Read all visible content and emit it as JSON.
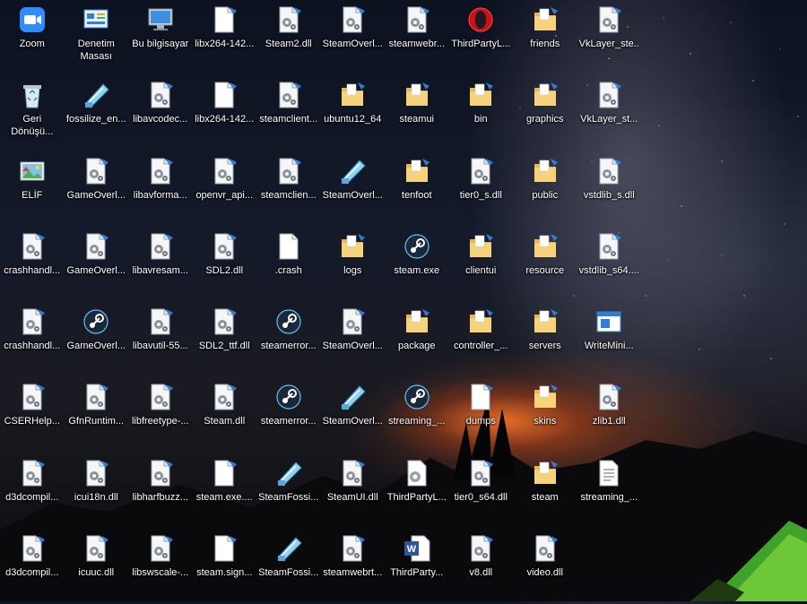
{
  "desktop": {
    "columns": [
      [
        {
          "label": "Zoom",
          "icon": "zoom"
        },
        {
          "label": "Geri Dönüşü...",
          "icon": "recycle"
        },
        {
          "label": "ELİF",
          "icon": "image"
        },
        {
          "label": "crashhandl...",
          "icon": "dll"
        },
        {
          "label": "crashhandl...",
          "icon": "dll"
        },
        {
          "label": "CSERHelp...",
          "icon": "dll"
        },
        {
          "label": "d3dcompil...",
          "icon": "dll"
        },
        {
          "label": "d3dcompil...",
          "icon": "dll"
        }
      ],
      [
        {
          "label": "Denetim Masası",
          "icon": "control-panel"
        },
        {
          "label": "fossilize_en...",
          "icon": "fossil"
        },
        {
          "label": "GameOverl...",
          "icon": "dll"
        },
        {
          "label": "GameOverl...",
          "icon": "dll"
        },
        {
          "label": "GameOverl...",
          "icon": "steam"
        },
        {
          "label": "GfnRuntim...",
          "icon": "dll"
        },
        {
          "label": "icui18n.dll",
          "icon": "dll"
        },
        {
          "label": "icuuc.dll",
          "icon": "dll"
        }
      ],
      [
        {
          "label": "Bu bilgisayar",
          "icon": "computer"
        },
        {
          "label": "libavcodec...",
          "icon": "dll"
        },
        {
          "label": "libavforma...",
          "icon": "dll"
        },
        {
          "label": "libavresam...",
          "icon": "dll"
        },
        {
          "label": "libavutil-55...",
          "icon": "dll"
        },
        {
          "label": "libfreetype-...",
          "icon": "dll"
        },
        {
          "label": "libharfbuzz...",
          "icon": "dll"
        },
        {
          "label": "libswscale-...",
          "icon": "dll"
        }
      ],
      [
        {
          "label": "libx264-142...",
          "icon": "file"
        },
        {
          "label": "libx264-142...",
          "icon": "file"
        },
        {
          "label": "openvr_api...",
          "icon": "dll"
        },
        {
          "label": "SDL2.dll",
          "icon": "dll"
        },
        {
          "label": "SDL2_ttf.dll",
          "icon": "dll"
        },
        {
          "label": "Steam.dll",
          "icon": "dll"
        },
        {
          "label": "steam.exe....",
          "icon": "file"
        },
        {
          "label": "steam.sign...",
          "icon": "file"
        }
      ],
      [
        {
          "label": "Steam2.dll",
          "icon": "dll"
        },
        {
          "label": "steamclient...",
          "icon": "dll"
        },
        {
          "label": "steamclien...",
          "icon": "dll"
        },
        {
          "label": ".crash",
          "icon": "blank"
        },
        {
          "label": "steamerror...",
          "icon": "steam"
        },
        {
          "label": "steamerror...",
          "icon": "steam"
        },
        {
          "label": "SteamFossi...",
          "icon": "fossil"
        },
        {
          "label": "SteamFossi...",
          "icon": "fossil"
        }
      ],
      [
        {
          "label": "SteamOverl...",
          "icon": "dll"
        },
        {
          "label": "ubuntu12_64",
          "icon": "folder"
        },
        {
          "label": "SteamOverl...",
          "icon": "fossil"
        },
        {
          "label": "logs",
          "icon": "folder"
        },
        {
          "label": "SteamOverl...",
          "icon": "dll"
        },
        {
          "label": "SteamOverl...",
          "icon": "fossil"
        },
        {
          "label": "SteamUI.dll",
          "icon": "dll"
        },
        {
          "label": "steamwebrt...",
          "icon": "dll"
        }
      ],
      [
        {
          "label": "steamwebr...",
          "icon": "dll"
        },
        {
          "label": "steamui",
          "icon": "folder"
        },
        {
          "label": "tenfoot",
          "icon": "folder"
        },
        {
          "label": "steam.exe",
          "icon": "steam"
        },
        {
          "label": "package",
          "icon": "folder"
        },
        {
          "label": "streaming_...",
          "icon": "steam"
        },
        {
          "label": "ThirdPartyL...",
          "icon": "gear-file"
        },
        {
          "label": "ThirdParty...",
          "icon": "word"
        }
      ],
      [
        {
          "label": "ThirdPartyL...",
          "icon": "opera"
        },
        {
          "label": "bin",
          "icon": "folder"
        },
        {
          "label": "tier0_s.dll",
          "icon": "dll"
        },
        {
          "label": "clientui",
          "icon": "folder"
        },
        {
          "label": "controller_...",
          "icon": "folder"
        },
        {
          "label": "dumps",
          "icon": "file"
        },
        {
          "label": "tier0_s64.dll",
          "icon": "dll"
        },
        {
          "label": "v8.dll",
          "icon": "dll"
        }
      ],
      [
        {
          "label": "friends",
          "icon": "folder"
        },
        {
          "label": "graphics",
          "icon": "folder"
        },
        {
          "label": "public",
          "icon": "folder"
        },
        {
          "label": "resource",
          "icon": "folder"
        },
        {
          "label": "servers",
          "icon": "folder"
        },
        {
          "label": "skins",
          "icon": "folder"
        },
        {
          "label": "steam",
          "icon": "folder"
        },
        {
          "label": "video.dll",
          "icon": "dll"
        }
      ],
      [
        {
          "label": "VkLayer_ste...",
          "icon": "dll"
        },
        {
          "label": "VkLayer_st...",
          "icon": "dll"
        },
        {
          "label": "vstdlib_s.dll",
          "icon": "dll"
        },
        {
          "label": "vstdlib_s64....",
          "icon": "dll"
        },
        {
          "label": "WriteMini...",
          "icon": "app"
        },
        {
          "label": "zlib1.dll",
          "icon": "dll"
        },
        {
          "label": "streaming_...",
          "icon": "text"
        }
      ]
    ]
  }
}
